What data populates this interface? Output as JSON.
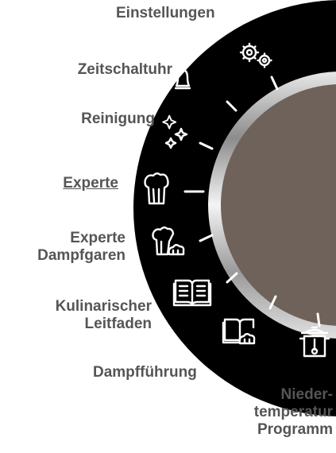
{
  "colors": {
    "ring": "#000000",
    "knob_center": "#6f625a",
    "label_text": "#555555",
    "icon": "#ffffff"
  },
  "menu": {
    "selected": "Experte",
    "items": [
      {
        "label": "Einstellungen",
        "icon": "gears-icon"
      },
      {
        "label": "Zeitschaltuhr",
        "icon": "bell-icon"
      },
      {
        "label": "Reinigung",
        "icon": "sparkles-icon"
      },
      {
        "label": "Experte",
        "icon": "chef-hat-icon"
      },
      {
        "label_line1": "Experte",
        "label_line2": "Dampfgaren",
        "icon": "chef-hat-steam-icon"
      },
      {
        "label_line1": "Kulinarischer",
        "label_line2": "Leitfaden",
        "icon": "book-icon"
      },
      {
        "label": "Dampfführung",
        "icon": "book-steam-icon"
      },
      {
        "label_line1": "Nieder-",
        "label_line2": "temperatur",
        "label_line3": "Programm",
        "icon": "pot-thermometer-icon"
      }
    ]
  }
}
